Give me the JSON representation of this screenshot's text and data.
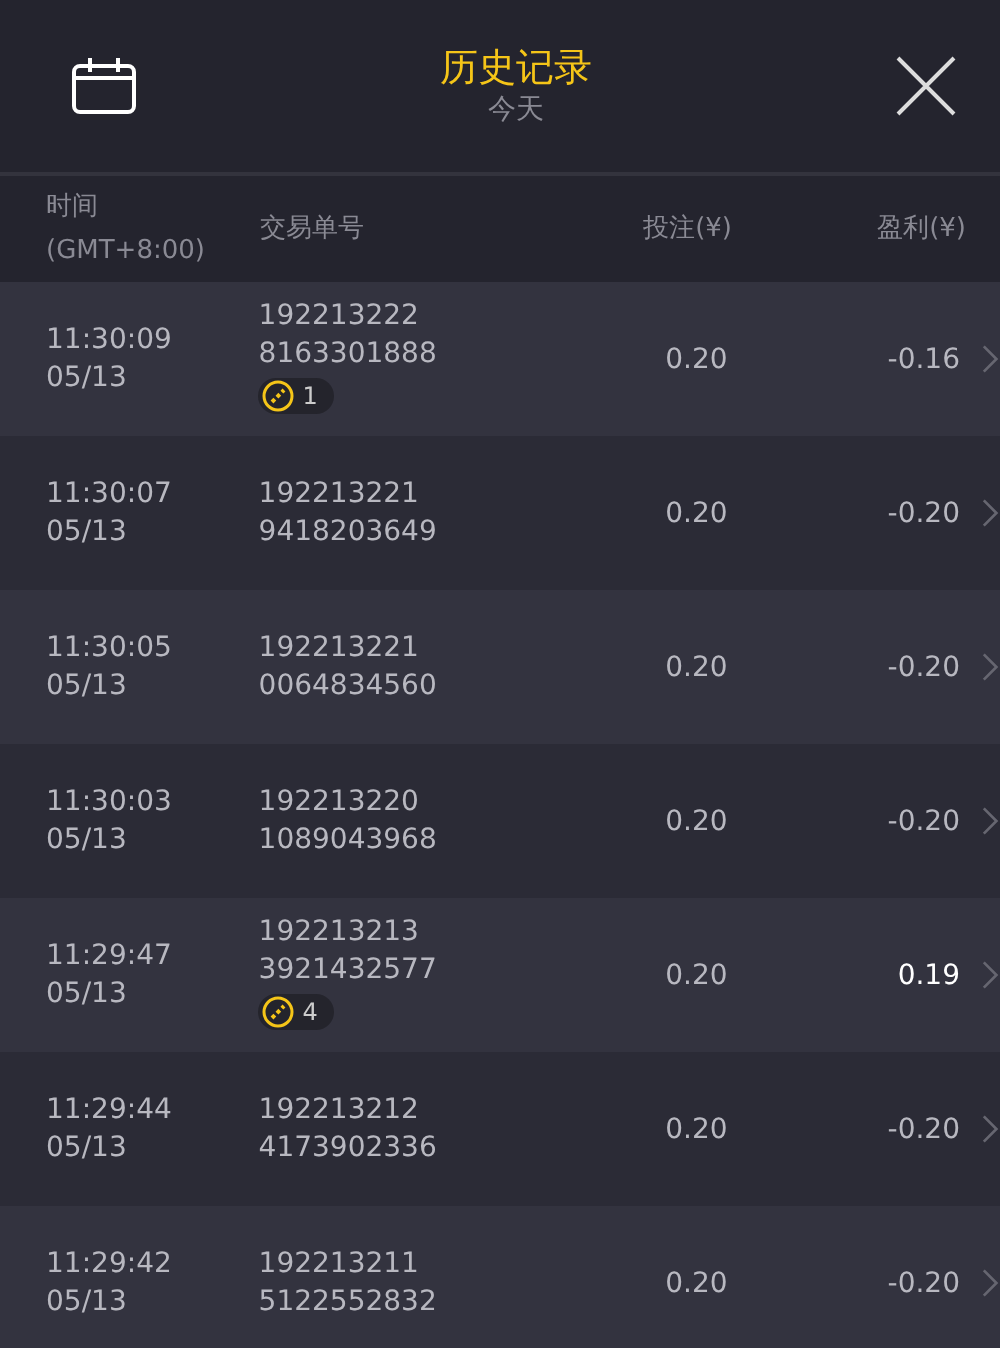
{
  "header": {
    "title": "历史记录",
    "subtitle": "今天"
  },
  "columns": [
    {
      "lines": [
        "时间",
        "(GMT+8:00)"
      ]
    },
    {
      "lines": [
        "交易单号"
      ]
    },
    {
      "lines": [
        "投注(¥)"
      ]
    },
    {
      "lines": [
        "盈利(¥)"
      ]
    }
  ],
  "rows": [
    {
      "time": "11:30:09",
      "date": "05/13",
      "order": [
        "192213222",
        "8163301888"
      ],
      "badge": "1",
      "bet": "0.20",
      "profit": "-0.16",
      "win": false
    },
    {
      "time": "11:30:07",
      "date": "05/13",
      "order": [
        "192213221",
        "9418203649"
      ],
      "bet": "0.20",
      "profit": "-0.20",
      "win": false
    },
    {
      "time": "11:30:05",
      "date": "05/13",
      "order": [
        "192213221",
        "0064834560"
      ],
      "bet": "0.20",
      "profit": "-0.20",
      "win": false
    },
    {
      "time": "11:30:03",
      "date": "05/13",
      "order": [
        "192213220",
        "1089043968"
      ],
      "bet": "0.20",
      "profit": "-0.20",
      "win": false
    },
    {
      "time": "11:29:47",
      "date": "05/13",
      "order": [
        "192213213",
        "3921432577"
      ],
      "badge": "4",
      "bet": "0.20",
      "profit": "0.19",
      "win": true
    },
    {
      "time": "11:29:44",
      "date": "05/13",
      "order": [
        "192213212",
        "4173902336"
      ],
      "bet": "0.20",
      "profit": "-0.20",
      "win": false
    },
    {
      "time": "11:29:42",
      "date": "05/13",
      "order": [
        "192213211",
        "5122552832"
      ],
      "bet": "0.20",
      "profit": "-0.20",
      "win": false
    }
  ]
}
